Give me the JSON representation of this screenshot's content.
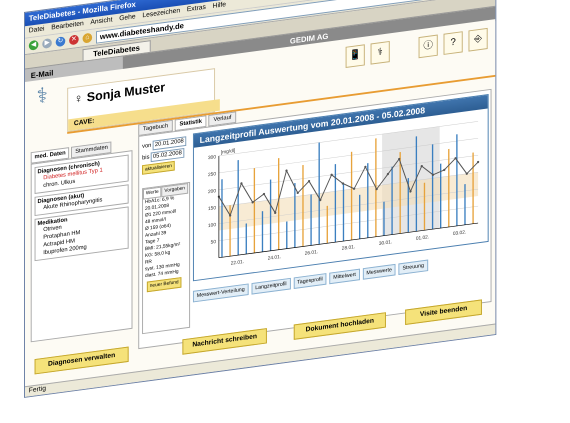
{
  "window": {
    "title": "TeleDiabetes - Mozilla Firefox",
    "min": "_",
    "max": "□",
    "close": "X"
  },
  "menu": [
    "Datei",
    "Bearbeiten",
    "Ansicht",
    "Gehe",
    "Lesezeichen",
    "Extras",
    "Hilfe"
  ],
  "address": {
    "url": "www.diabeteshandy.de",
    "go_label": "Go"
  },
  "browser_tab": {
    "label": "TeleDiabetes"
  },
  "topstrip": {
    "email": "E-Mail",
    "org": "GEDIM AG"
  },
  "patient": {
    "name": "Sonja Muster",
    "gender_symbol": "♀",
    "cave_label": "CAVE:"
  },
  "left_tabs": [
    "med. Daten",
    "Stammdaten"
  ],
  "diagnoses_chronic": {
    "title": "Diagnosen (chronisch)",
    "items": [
      {
        "text": "Diabetes mellitus Typ 1",
        "highlight": true
      },
      {
        "text": "chron. Ulkus",
        "highlight": false
      }
    ]
  },
  "diagnoses_acute": {
    "title": "Diagnosen (akut)",
    "items": [
      "Akute Rhinopharyngitis"
    ]
  },
  "medication": {
    "title": "Medikation",
    "items": [
      "Otriven",
      "Protaphan HM",
      "Actrapid HM",
      "Ibuprofen 200mg"
    ]
  },
  "main_tabs": [
    "Tagebuch",
    "Statistik",
    "Verlauf"
  ],
  "dates": {
    "from_label": "von",
    "from": "20.01.2008",
    "to_label": "bis",
    "to": "05.02.2008",
    "refresh": "aktualisieren"
  },
  "werte_tabs": [
    "Werte",
    "Vorgaben"
  ],
  "werte_lines": [
    "HbA1c: 6,9 %",
    "20.01.2008",
    "Ø1 220 mmol/l",
    "48 mmol/l",
    "Ø 159 (σ64)",
    "Anzahl 39",
    "Tage 7",
    "BMI: 21,55kg/m²",
    "KG: 58,0 kg",
    "RR",
    "syst. 130 mmHg",
    "diast. 74 mmHg"
  ],
  "werte_button": "neuer Befund",
  "chart_data": {
    "type": "bar",
    "title": "Langzeitprofil Auswertung vom 20.01.2008 - 05.02.2008",
    "ylabel": "[mg/dl]",
    "ylim": [
      0,
      300
    ],
    "yticks": [
      50,
      100,
      150,
      200,
      250,
      300
    ],
    "xticks": [
      "22.01.",
      "24.01.",
      "26.01.",
      "28.01.",
      "30.01.",
      "01.02.",
      "03.02."
    ],
    "bars": [
      230,
      150,
      280,
      90,
      250,
      120,
      210,
      270,
      80,
      190,
      240,
      150,
      300,
      110,
      230,
      170,
      260,
      130,
      220,
      290,
      100,
      200,
      240,
      160,
      280,
      140,
      250,
      190,
      230,
      270,
      120,
      210
    ],
    "line": [
      180,
      120,
      210,
      150,
      170,
      110,
      230,
      160,
      190,
      130,
      200,
      170,
      150,
      210,
      140,
      180,
      220,
      120,
      190,
      160,
      170,
      200,
      150,
      180
    ],
    "colors": {
      "bars_blue": "#3b7fc0",
      "bars_orange": "#e7a33c",
      "line": "#555555"
    }
  },
  "view_buttons": [
    "Messwert-Verteilung",
    "Langzeitprofil",
    "Tagesprofil",
    "Mittelwert",
    "Messwerte",
    "Streuung"
  ],
  "actions": {
    "diag": "Diagnosen verwalten",
    "msg": "Nachricht schreiben",
    "upload": "Dokument hochladen",
    "end": "Visite beenden"
  },
  "status": "Fertig"
}
